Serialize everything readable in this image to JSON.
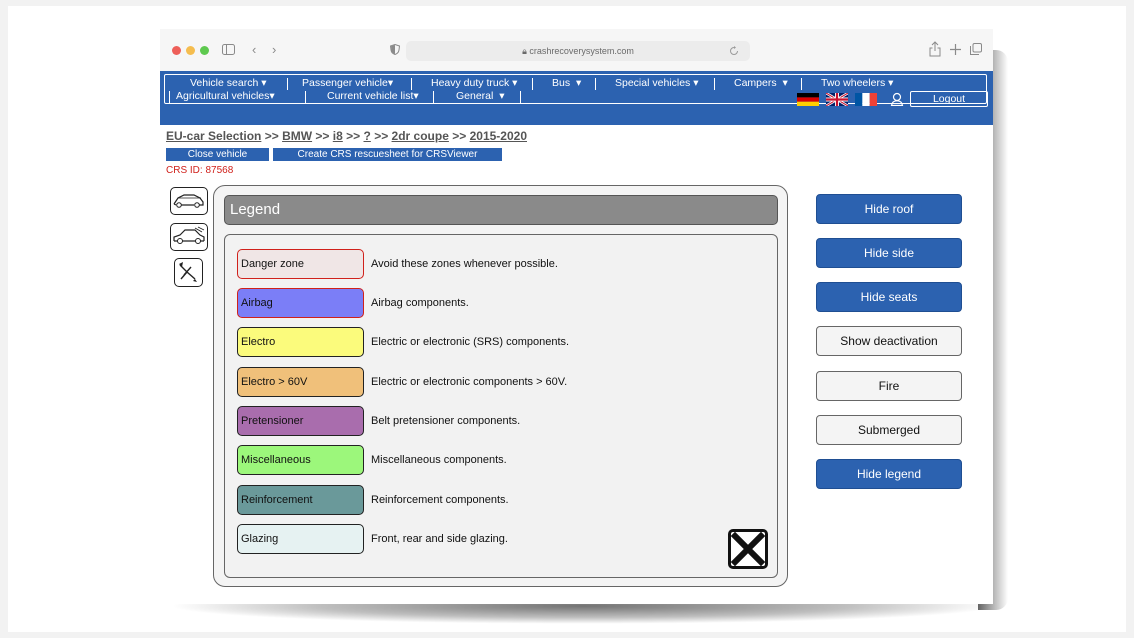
{
  "browser": {
    "url": "crashrecoverysystem.com"
  },
  "nav": {
    "menu": [
      "Vehicle search",
      "Passenger vehicle",
      "Heavy duty truck",
      "Bus",
      "Special vehicles",
      "Campers",
      "Two wheelers",
      "Agricultural vehicles",
      "Current vehicle list",
      "General"
    ],
    "logout": "Logout"
  },
  "breadcrumb": {
    "root": "EU-car Selection",
    "sep": ">>",
    "make": "BMW",
    "model": "i8",
    "variant": "?",
    "body": "2dr coupe",
    "years": "2015-2020"
  },
  "actions": {
    "close_vehicle": "Close vehicle",
    "create_sheet": "Create CRS rescuesheet for CRSViewer"
  },
  "crs_id": "CRS ID: 87568",
  "legend": {
    "title": "Legend",
    "items": [
      {
        "label": "Danger zone",
        "desc": "Avoid these zones whenever possible.",
        "color": "#f0e6e6",
        "border": "#d0211b"
      },
      {
        "label": "Airbag",
        "desc": "Airbag components.",
        "color": "#7b7ef7",
        "border": "#d0211b"
      },
      {
        "label": "Electro",
        "desc": "Electric or electronic (SRS) components.",
        "color": "#fbfb7c",
        "border": "#222222"
      },
      {
        "label": "Electro > 60V",
        "desc": "Electric or electronic components > 60V.",
        "color": "#f0c07a",
        "border": "#222222"
      },
      {
        "label": "Pretensioner",
        "desc": "Belt pretensioner components.",
        "color": "#a96dad",
        "border": "#222222"
      },
      {
        "label": "Miscellaneous",
        "desc": "Miscellaneous components.",
        "color": "#9cf77b",
        "border": "#222222"
      },
      {
        "label": "Reinforcement",
        "desc": "Reinforcement components.",
        "color": "#6a999a",
        "border": "#222222"
      },
      {
        "label": "Glazing",
        "desc": "Front, rear and side glazing.",
        "color": "#e6f2f2",
        "border": "#222222"
      }
    ]
  },
  "right_buttons": [
    {
      "label": "Hide roof",
      "style": "blue"
    },
    {
      "label": "Hide side",
      "style": "blue"
    },
    {
      "label": "Hide seats",
      "style": "blue"
    },
    {
      "label": "Show deactivation",
      "style": "white"
    },
    {
      "label": "Fire",
      "style": "white"
    },
    {
      "label": "Submerged",
      "style": "white"
    },
    {
      "label": "Hide legend",
      "style": "blue"
    }
  ],
  "colors": {
    "brand_blue": "#2c62b0",
    "crs_red": "#d0211b"
  }
}
